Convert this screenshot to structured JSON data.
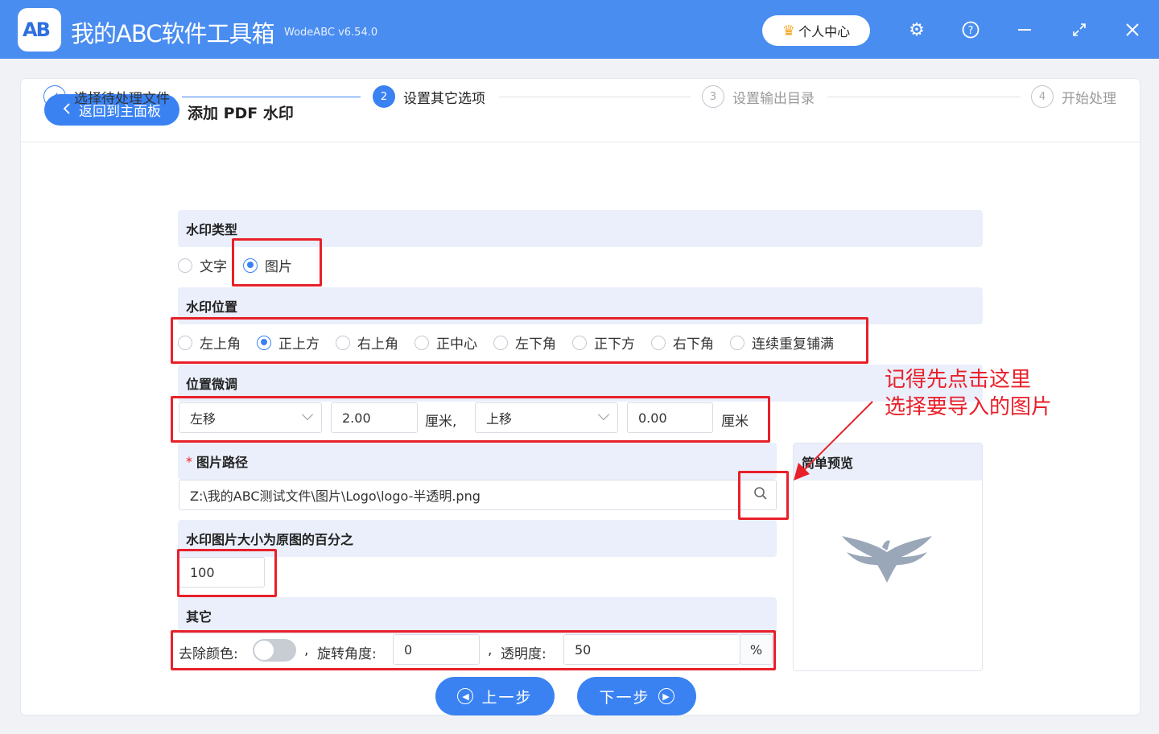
{
  "app": {
    "logo_text": "AB",
    "title": "我的ABC软件工具箱",
    "version": "WodeABC v6.54.0",
    "user_center": "个人中心"
  },
  "header": {
    "back_label": "返回到主面板",
    "page_title": "添加 PDF 水印"
  },
  "steps": [
    {
      "label": "选择待处理文件",
      "marker": "✓",
      "state": "done"
    },
    {
      "label": "设置其它选项",
      "marker": "2",
      "state": "active"
    },
    {
      "label": "设置输出目录",
      "marker": "3",
      "state": "idle"
    },
    {
      "label": "开始处理",
      "marker": "4",
      "state": "idle"
    }
  ],
  "watermark_type": {
    "heading": "水印类型",
    "options": [
      "文字",
      "图片"
    ],
    "selected": "图片"
  },
  "watermark_position": {
    "heading": "水印位置",
    "options": [
      "左上角",
      "正上方",
      "右上角",
      "正中心",
      "左下角",
      "正下方",
      "右下角",
      "连续重复铺满"
    ],
    "selected": "正上方"
  },
  "fine_tune": {
    "heading": "位置微调",
    "horizontal_dir": "左移",
    "horizontal_value": "2.00",
    "unit_1": "厘米,",
    "vertical_dir": "上移",
    "vertical_value": "0.00",
    "unit_2": "厘米"
  },
  "image_path": {
    "required_mark": "*",
    "heading": "图片路径",
    "value": "Z:\\我的ABC测试文件\\图片\\Logo\\logo-半透明.png"
  },
  "size_percent": {
    "heading": "水印图片大小为原图的百分之",
    "value": "100"
  },
  "other": {
    "heading": "其它",
    "remove_color_label": "去除颜色:",
    "remove_color_on": false,
    "sep_1": ",",
    "rotation_label": "旋转角度:",
    "rotation_value": "0",
    "sep_2": ",",
    "opacity_label": "透明度:",
    "opacity_value": "50",
    "opacity_unit": "%"
  },
  "preview": {
    "heading": "简单预览"
  },
  "annotation": {
    "line1": "记得先点击这里",
    "line2": "选择要导入的图片"
  },
  "nav": {
    "prev": "上一步",
    "next": "下一步"
  },
  "colors": {
    "titlebar": "#4a8df0",
    "accent": "#3a82f2",
    "highlight": "#e8202a"
  }
}
